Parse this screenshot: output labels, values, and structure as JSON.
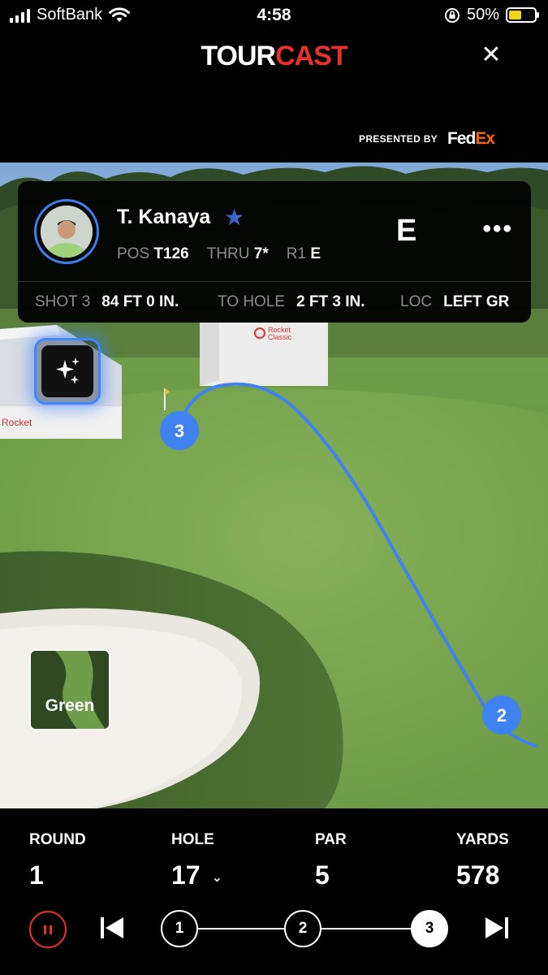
{
  "status_bar": {
    "carrier": "SoftBank",
    "time": "4:58",
    "battery": "50%"
  },
  "header": {
    "logo_tour": "TOUR",
    "logo_cast": "CAST",
    "close_icon": "close-icon",
    "presented_by": "PRESENTED BY",
    "sponsor_fed": "Fed",
    "sponsor_ex": "Ex"
  },
  "player": {
    "name": "T. Kanaya",
    "pos_label": "POS",
    "pos_value": "T126",
    "thru_label": "THRU",
    "thru_value": "7*",
    "round_label": "R1",
    "round_value": "E",
    "score": "E"
  },
  "shot_info": {
    "shot_label": "SHOT 3",
    "shot_value": "84 FT 0 IN.",
    "to_hole_label": "TO HOLE",
    "to_hole_value": "2 FT 3 IN.",
    "loc_label": "LOC",
    "loc_value": "LEFT GR"
  },
  "scene": {
    "signage": [
      "Rocket",
      "Classic"
    ],
    "shot_markers": [
      "3",
      "2"
    ],
    "view_label": "Green"
  },
  "hole_info": {
    "round_label": "ROUND",
    "round_value": "1",
    "hole_label": "HOLE",
    "hole_value": "17",
    "par_label": "PAR",
    "par_value": "5",
    "yards_label": "YARDS",
    "yards_value": "578"
  },
  "playback": {
    "shots": [
      "1",
      "2",
      "3"
    ],
    "active_shot": "3"
  },
  "colors": {
    "brand_red": "#e8312a",
    "accent_blue": "#3d7ff0",
    "fedex_orange": "#ff6200"
  }
}
